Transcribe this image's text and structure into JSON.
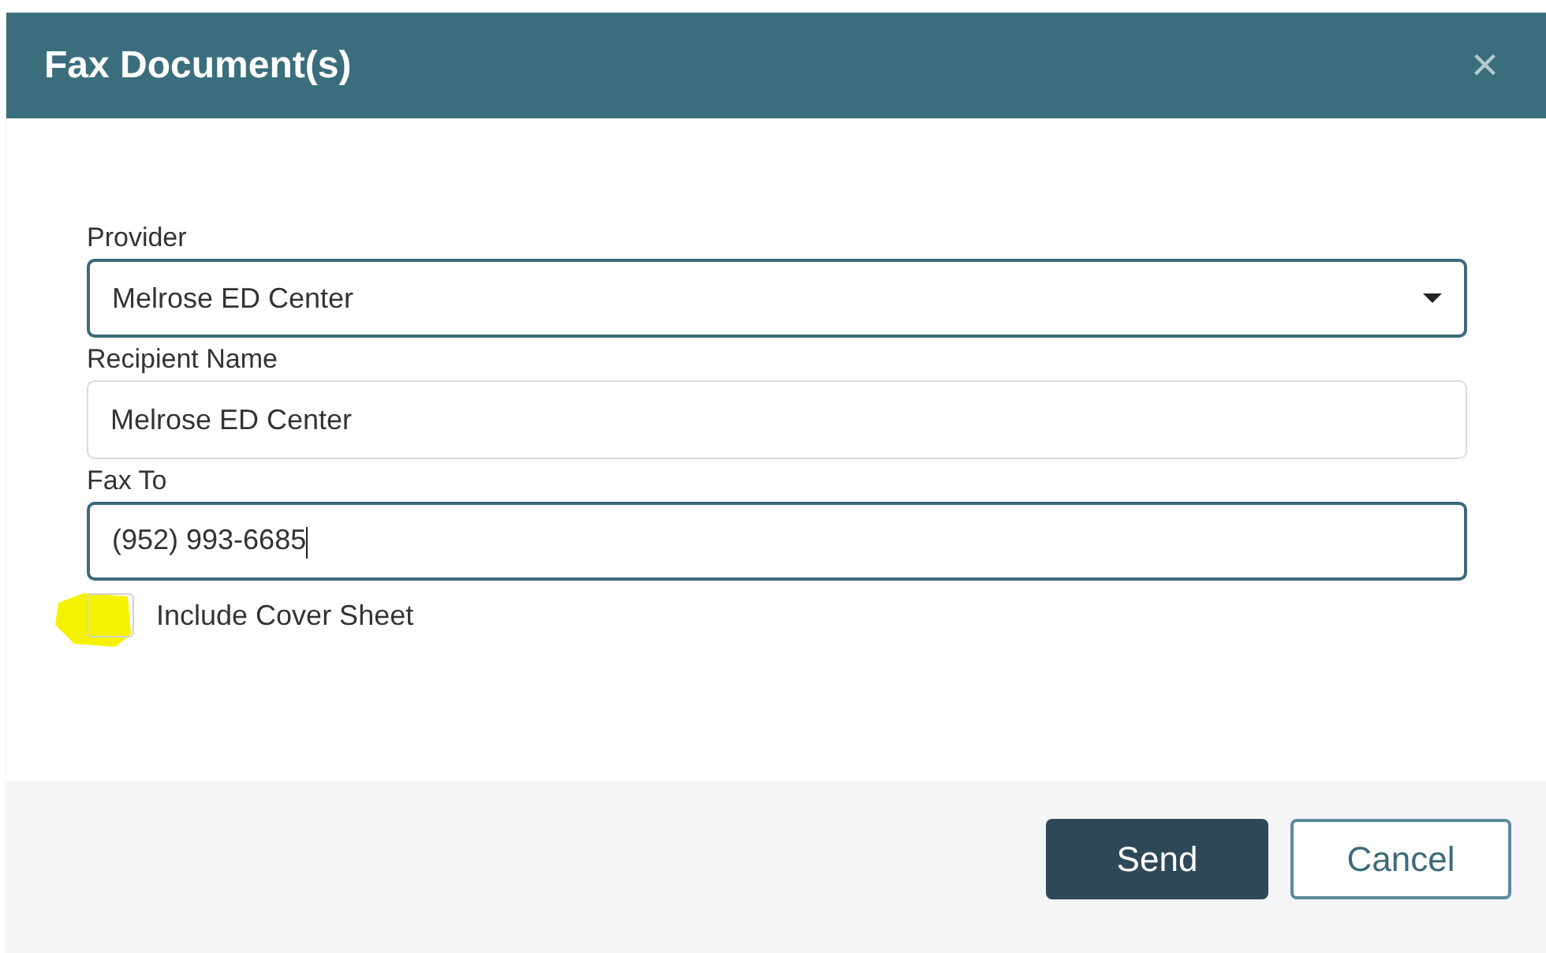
{
  "dialog": {
    "title": "Fax Document(s)",
    "close": "×"
  },
  "fields": [
    {
      "kind": "select",
      "label": "Provider",
      "value": "Melrose ED Center",
      "focused": true
    },
    {
      "kind": "text",
      "label": "Recipient Name",
      "value": "Melrose ED Center",
      "focused": false
    },
    {
      "kind": "text",
      "label": "Fax To",
      "value": "(952) 993-6685",
      "focused": true
    }
  ],
  "cover_sheet": {
    "label": "Include Cover Sheet",
    "checked": false
  },
  "buttons": [
    {
      "label": "Send",
      "kind": "primary"
    },
    {
      "label": "Cancel",
      "kind": "secondary"
    }
  ]
}
